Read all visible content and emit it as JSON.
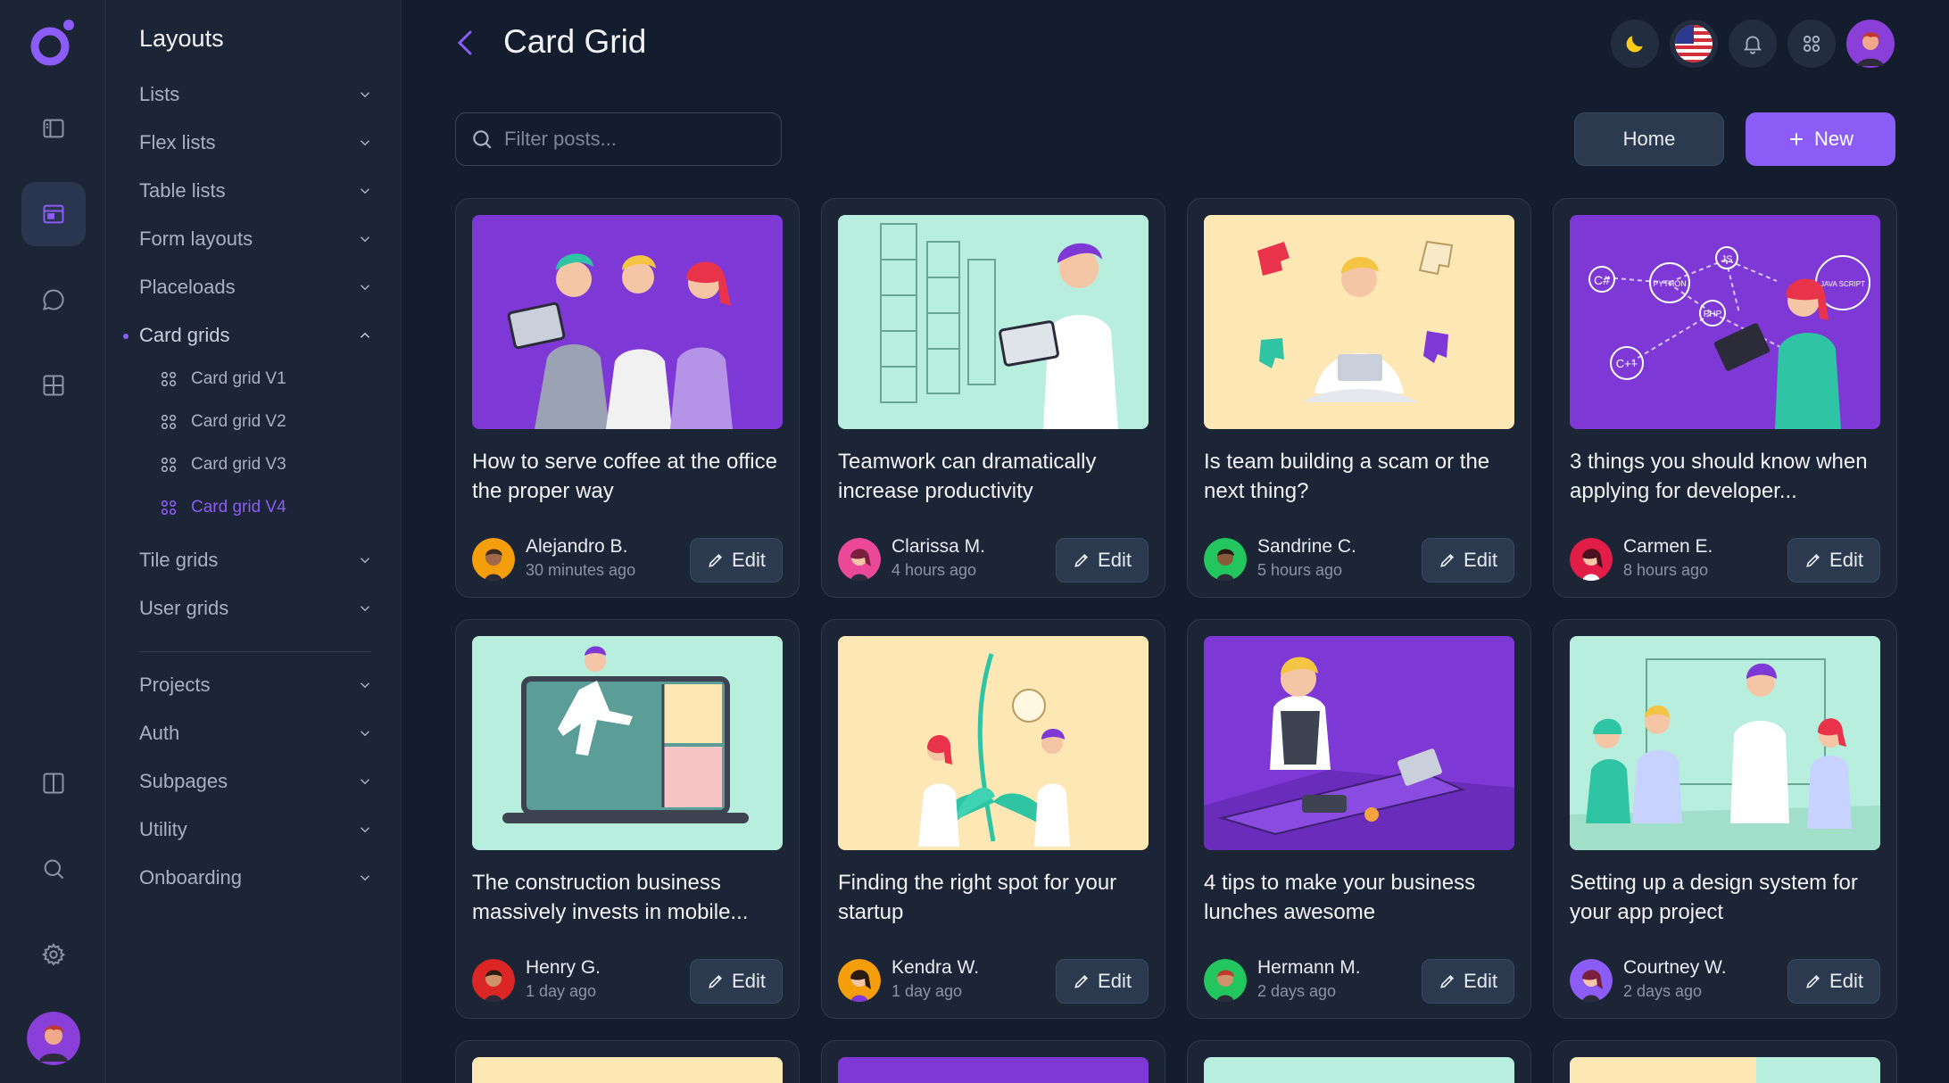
{
  "rail": {
    "icons": [
      "logo",
      "sidebar-icon",
      "layouts-icon",
      "chat-icon",
      "grid-icon",
      "columns-icon",
      "search-icon",
      "gear-icon",
      "avatar"
    ]
  },
  "subnav": {
    "title": "Layouts",
    "items": [
      {
        "label": "Lists"
      },
      {
        "label": "Flex lists"
      },
      {
        "label": "Table lists"
      },
      {
        "label": "Form layouts"
      },
      {
        "label": "Placeloads"
      },
      {
        "label": "Card grids"
      },
      {
        "label": "Tile grids"
      },
      {
        "label": "User grids"
      },
      {
        "label": "Projects"
      },
      {
        "label": "Auth"
      },
      {
        "label": "Subpages"
      },
      {
        "label": "Utility"
      },
      {
        "label": "Onboarding"
      }
    ],
    "card_grids_children": [
      {
        "label": "Card grid V1"
      },
      {
        "label": "Card grid V2"
      },
      {
        "label": "Card grid V3"
      },
      {
        "label": "Card grid V4"
      }
    ]
  },
  "header": {
    "title": "Card Grid",
    "icons": [
      "moon-icon",
      "us-flag-icon",
      "bell-icon",
      "apps-icon",
      "avatar"
    ]
  },
  "toolbar": {
    "search_placeholder": "Filter posts...",
    "home_label": "Home",
    "new_label": "New"
  },
  "colors": {
    "accent": "#8b5cf6",
    "background": "#141d2e",
    "panel": "#1c2536",
    "img_purple": "#7e38d6",
    "img_mint": "#b7eedd",
    "img_cream": "#fde8b5"
  },
  "cards": [
    {
      "title": "How to serve coffee at the office the proper way",
      "author": "Alejandro B.",
      "time": "30 minutes ago",
      "edit": "Edit",
      "bg": "#7e38d6"
    },
    {
      "title": "Teamwork can dramatically increase productivity",
      "author": "Clarissa M.",
      "time": "4 hours ago",
      "edit": "Edit",
      "bg": "#b7eedd"
    },
    {
      "title": "Is team building a scam or the next thing?",
      "author": "Sandrine C.",
      "time": "5 hours ago",
      "edit": "Edit",
      "bg": "#fde8b5"
    },
    {
      "title": "3 things you should know when applying for developer...",
      "author": "Carmen E.",
      "time": "8 hours ago",
      "edit": "Edit",
      "bg": "#7e38d6"
    },
    {
      "title": "The construction business massively invests in mobile...",
      "author": "Henry G.",
      "time": "1 day ago",
      "edit": "Edit",
      "bg": "#b7eedd"
    },
    {
      "title": "Finding the right spot for your startup",
      "author": "Kendra W.",
      "time": "1 day ago",
      "edit": "Edit",
      "bg": "#fde8b5"
    },
    {
      "title": "4 tips to make your business lunches awesome",
      "author": "Hermann M.",
      "time": "2 days ago",
      "edit": "Edit",
      "bg": "#7e38d6"
    },
    {
      "title": "Setting up a design system for your app project",
      "author": "Courtney W.",
      "time": "2 days ago",
      "edit": "Edit",
      "bg": "#b7eedd"
    }
  ],
  "illustration_text": {
    "card4_labels": [
      "C#",
      "PYTHON",
      "JS",
      "JAVA SCRIPT",
      "PHP",
      "C++"
    ]
  }
}
